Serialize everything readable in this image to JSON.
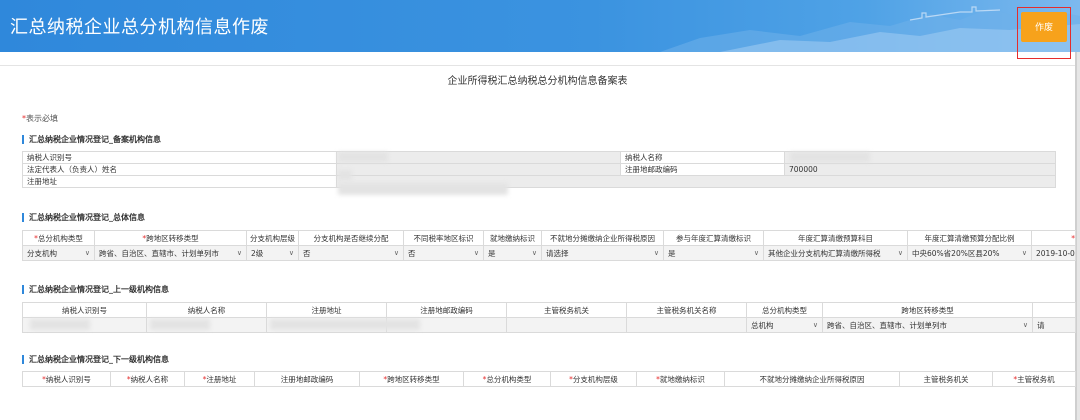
{
  "header": {
    "title": "汇总纳税企业总分机构信息作废",
    "void_button": "作废"
  },
  "form_title": "企业所得税汇总纳税总分机构信息备案表",
  "required_note": {
    "star": "*",
    "text": "表示必填"
  },
  "section1": {
    "title": "汇总纳税企业情况登记_备案机构信息",
    "labels": {
      "taxpayer_id": "纳税人识别号",
      "taxpayer_name": "纳税人名称",
      "legal_rep": "法定代表人（负责人）姓名",
      "reg_postcode": "注册地邮政编码",
      "reg_address": "注册地址"
    },
    "values": {
      "reg_postcode": "700000"
    }
  },
  "section2": {
    "title": "汇总纳税企业情况登记_总体信息",
    "headers": [
      {
        "req": "*",
        "text": "总分机构类型"
      },
      {
        "req": "*",
        "text": "跨地区转移类型"
      },
      {
        "req": "",
        "text": "分支机构层级"
      },
      {
        "req": "",
        "text": "分支机构是否继续分配"
      },
      {
        "req": "",
        "text": "不同税率地区标识"
      },
      {
        "req": "",
        "text": "就地缴纳标识"
      },
      {
        "req": "",
        "text": "不就地分摊缴纳企业所得税原因"
      },
      {
        "req": "",
        "text": "参与年度汇算清缴标识"
      },
      {
        "req": "",
        "text": "年度汇算清缴预算科目"
      },
      {
        "req": "",
        "text": "年度汇算清缴预算分配比例"
      },
      {
        "req": "*",
        "text": ""
      }
    ],
    "row": [
      "分支机构",
      "跨省、自治区、直辖市、计划单列市",
      "2级",
      "否",
      "否",
      "是",
      "请选择",
      "是",
      "其他企业分支机构汇算清缴所得税",
      "中央60%省20%区县20%",
      "2019-10-0"
    ]
  },
  "section3": {
    "title": "汇总纳税企业情况登记_上一级机构信息",
    "headers": [
      "纳税人识别号",
      "纳税人名称",
      "注册地址",
      "注册地邮政编码",
      "主管税务机关",
      "主管税务机关名称",
      "总分机构类型",
      "跨地区转移类型"
    ],
    "row": {
      "org_type": "总机构",
      "transfer_type": "跨省、自治区、直辖市、计划单列市",
      "tail": "请"
    }
  },
  "section4": {
    "title": "汇总纳税企业情况登记_下一级机构信息",
    "headers": [
      {
        "req": "*",
        "text": "纳税人识别号"
      },
      {
        "req": "*",
        "text": "纳税人名称"
      },
      {
        "req": "*",
        "text": "注册地址"
      },
      {
        "req": "",
        "text": "注册地邮政编码"
      },
      {
        "req": "*",
        "text": "跨地区转移类型"
      },
      {
        "req": "*",
        "text": "总分机构类型"
      },
      {
        "req": "*",
        "text": "分支机构层级"
      },
      {
        "req": "*",
        "text": "就地缴纳标识"
      },
      {
        "req": "",
        "text": "不就地分摊缴纳企业所得税原因"
      },
      {
        "req": "",
        "text": "主管税务机关"
      },
      {
        "req": "*",
        "text": "主管税务机"
      }
    ]
  },
  "icons": {
    "dropdown": "chevron-down-icon",
    "arrow_glyph": "∨"
  },
  "colors": {
    "header_blue": "#2f88db",
    "button_orange": "#f7a21b",
    "highlight_red": "#e62c2c"
  }
}
